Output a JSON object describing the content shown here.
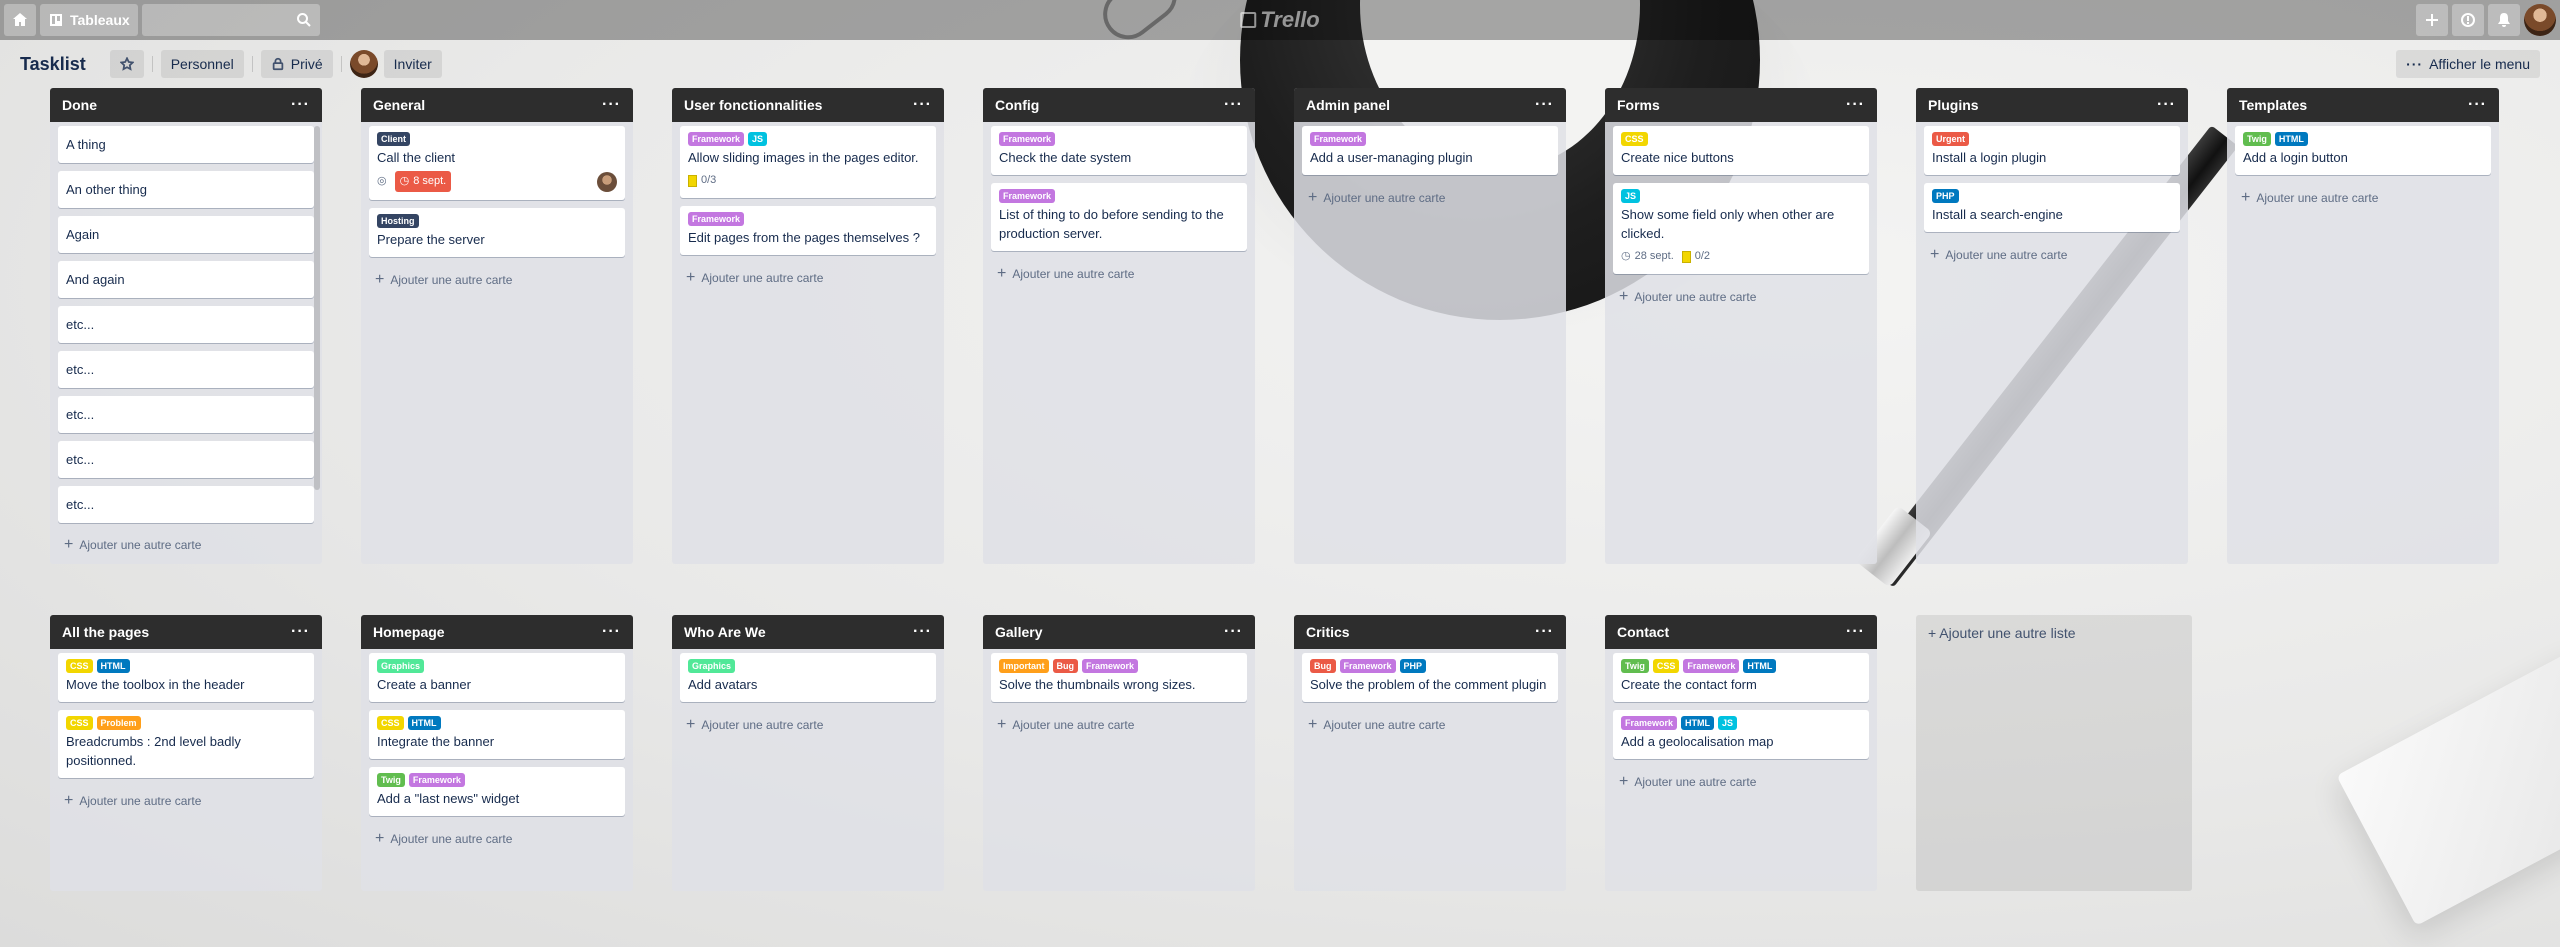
{
  "topbar": {
    "boards_label": "Tableaux",
    "search_placeholder": "",
    "logo": "Trello"
  },
  "board": {
    "title": "Tasklist",
    "visibility_personal": "Personnel",
    "visibility_private": "Privé",
    "invite": "Inviter",
    "show_menu": "Afficher le menu"
  },
  "add_card_label": "Ajouter une autre carte",
  "add_list_label": "Ajouter une autre liste",
  "colors": {
    "Framework": "#c377e0",
    "JS": "#00c2e0",
    "CSS": "#f2d600",
    "HTML": "#0079bf",
    "Twig": "#61bd4f",
    "PHP": "#0079bf",
    "Urgent": "#eb5a46",
    "Client": "#344563",
    "Hosting": "#344563",
    "Graphics": "#51e898",
    "Problem": "#ff9f1a",
    "Important": "#ff9f1a",
    "Bug": "#eb5a46"
  },
  "lists_row1": [
    {
      "title": "Done",
      "cards": [
        {
          "text": "A thing",
          "labels": []
        },
        {
          "text": "An other thing",
          "labels": []
        },
        {
          "text": "Again",
          "labels": []
        },
        {
          "text": "And again",
          "labels": []
        },
        {
          "text": "etc...",
          "labels": []
        },
        {
          "text": "etc...",
          "labels": []
        },
        {
          "text": "etc...",
          "labels": []
        },
        {
          "text": "etc...",
          "labels": []
        },
        {
          "text": "etc...",
          "labels": []
        }
      ]
    },
    {
      "title": "General",
      "cards": [
        {
          "text": "Call the client",
          "labels": [
            "Client"
          ],
          "due": "8 sept.",
          "watch": true,
          "avatar": true
        },
        {
          "text": "Prepare the server",
          "labels": [
            "Hosting"
          ]
        }
      ]
    },
    {
      "title": "User fonctionnalities",
      "cards": [
        {
          "text": "Allow sliding images in the pages editor.",
          "labels": [
            "Framework",
            "JS"
          ],
          "checklist": "0/3"
        },
        {
          "text": "Edit pages from the pages themselves ?",
          "labels": [
            "Framework"
          ]
        }
      ]
    },
    {
      "title": "Config",
      "cards": [
        {
          "text": "Check the date system",
          "labels": [
            "Framework"
          ]
        },
        {
          "text": "List of thing to do before sending to the production server.",
          "labels": [
            "Framework"
          ]
        }
      ]
    },
    {
      "title": "Admin panel",
      "cards": [
        {
          "text": "Add a user-managing plugin",
          "labels": [
            "Framework"
          ]
        }
      ]
    },
    {
      "title": "Forms",
      "cards": [
        {
          "text": "Create nice buttons",
          "labels": [
            "CSS"
          ]
        },
        {
          "text": "Show some field only when other are clicked.",
          "labels": [
            "JS"
          ],
          "date": "28 sept.",
          "checklist": "0/2"
        }
      ]
    },
    {
      "title": "Plugins",
      "cards": [
        {
          "text": "Install a login plugin",
          "labels": [
            "Urgent"
          ]
        },
        {
          "text": "Install a search-engine",
          "labels": [
            "PHP"
          ]
        }
      ]
    },
    {
      "title": "Templates",
      "cards": [
        {
          "text": "Add a login button",
          "labels": [
            "Twig",
            "HTML"
          ]
        }
      ]
    }
  ],
  "lists_row2": [
    {
      "title": "All the pages",
      "cards": [
        {
          "text": "Move the toolbox in the header",
          "labels": [
            "CSS",
            "HTML"
          ]
        },
        {
          "text": "Breadcrumbs : 2nd level badly positionned.",
          "labels": [
            "CSS",
            "Problem"
          ]
        }
      ]
    },
    {
      "title": "Homepage",
      "cards": [
        {
          "text": "Create a banner",
          "labels": [
            "Graphics"
          ]
        },
        {
          "text": "Integrate the banner",
          "labels": [
            "CSS",
            "HTML"
          ]
        },
        {
          "text": "Add a \"last news\" widget",
          "labels": [
            "Twig",
            "Framework"
          ]
        }
      ]
    },
    {
      "title": "Who Are We",
      "cards": [
        {
          "text": "Add avatars",
          "labels": [
            "Graphics"
          ]
        }
      ]
    },
    {
      "title": "Gallery",
      "cards": [
        {
          "text": "Solve the thumbnails wrong sizes.",
          "labels": [
            "Important",
            "Bug",
            "Framework"
          ]
        }
      ]
    },
    {
      "title": "Critics",
      "cards": [
        {
          "text": "Solve the problem of the comment plugin",
          "labels": [
            "Bug",
            "Framework",
            "PHP"
          ]
        }
      ]
    },
    {
      "title": "Contact",
      "cards": [
        {
          "text": "Create the contact form",
          "labels": [
            "Twig",
            "CSS",
            "Framework",
            "HTML"
          ]
        },
        {
          "text": "Add a geolocalisation map",
          "labels": [
            "Framework",
            "HTML",
            "JS"
          ]
        }
      ]
    }
  ]
}
